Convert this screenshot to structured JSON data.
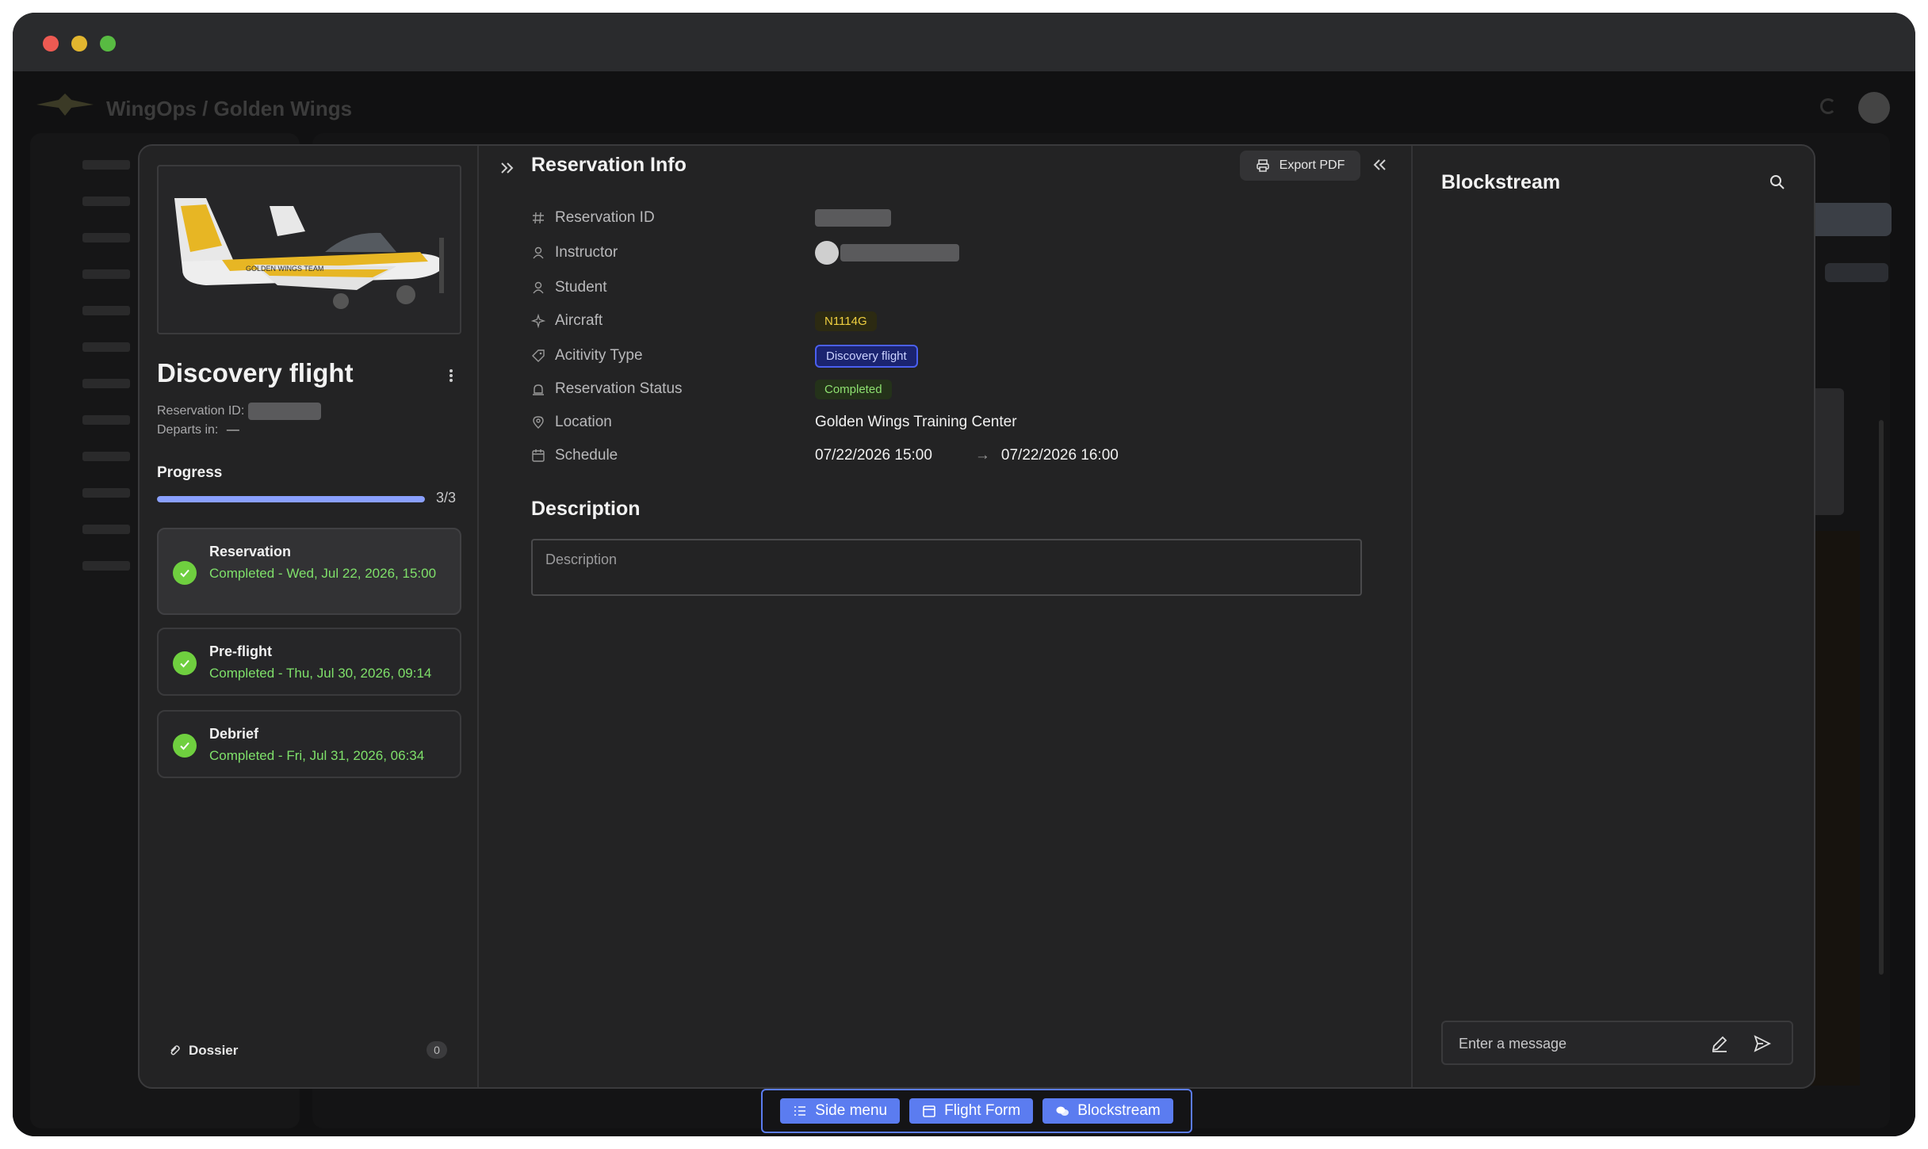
{
  "app": {
    "header_title": "WingOps / Golden Wings"
  },
  "flight": {
    "title": "Discovery flight",
    "reservation_id_label": "Reservation ID:",
    "departs_in_label": "Departs in:",
    "departs_in_value": "—",
    "progress_label": "Progress",
    "progress_count": "3/3",
    "progress_fraction": 1.0,
    "steps": [
      {
        "name": "Reservation",
        "status": "Completed - Wed, Jul 22, 2026, 15:00"
      },
      {
        "name": "Pre-flight",
        "status": "Completed - Thu, Jul 30, 2026, 09:14"
      },
      {
        "name": "Debrief",
        "status": "Completed - Fri, Jul 31, 2026, 06:34"
      }
    ],
    "dossier_label": "Dossier",
    "dossier_count": "0"
  },
  "reservation": {
    "section_title": "Reservation Info",
    "export_label": "Export PDF",
    "fields": [
      {
        "label": "Reservation ID",
        "icon": "hash-icon"
      },
      {
        "label": "Instructor",
        "icon": "user-icon"
      },
      {
        "label": "Student",
        "icon": "user-icon"
      },
      {
        "label": "Aircraft",
        "icon": "plane-icon",
        "value": "N1114G"
      },
      {
        "label": "Acitivity Type",
        "icon": "tag-icon",
        "value": "Discovery flight"
      },
      {
        "label": "Reservation Status",
        "icon": "siren-icon",
        "value": "Completed"
      },
      {
        "label": "Location",
        "icon": "pin-icon",
        "value": "Golden Wings Training Center"
      },
      {
        "label": "Schedule",
        "icon": "calendar-icon",
        "start": "07/22/2026 15:00",
        "arrow": "→",
        "end": "07/22/2026 16:00"
      }
    ],
    "description_title": "Description",
    "description_placeholder": "Description"
  },
  "blockstream": {
    "title": "Blockstream",
    "message_placeholder": "Enter a message"
  },
  "bottom_bar": {
    "side_menu": "Side menu",
    "flight_form": "Flight Form",
    "blockstream": "Blockstream"
  },
  "colors": {
    "accent": "#5b7cf0",
    "success": "#6fcf3f",
    "aircraft_tag": "#f0d040"
  }
}
